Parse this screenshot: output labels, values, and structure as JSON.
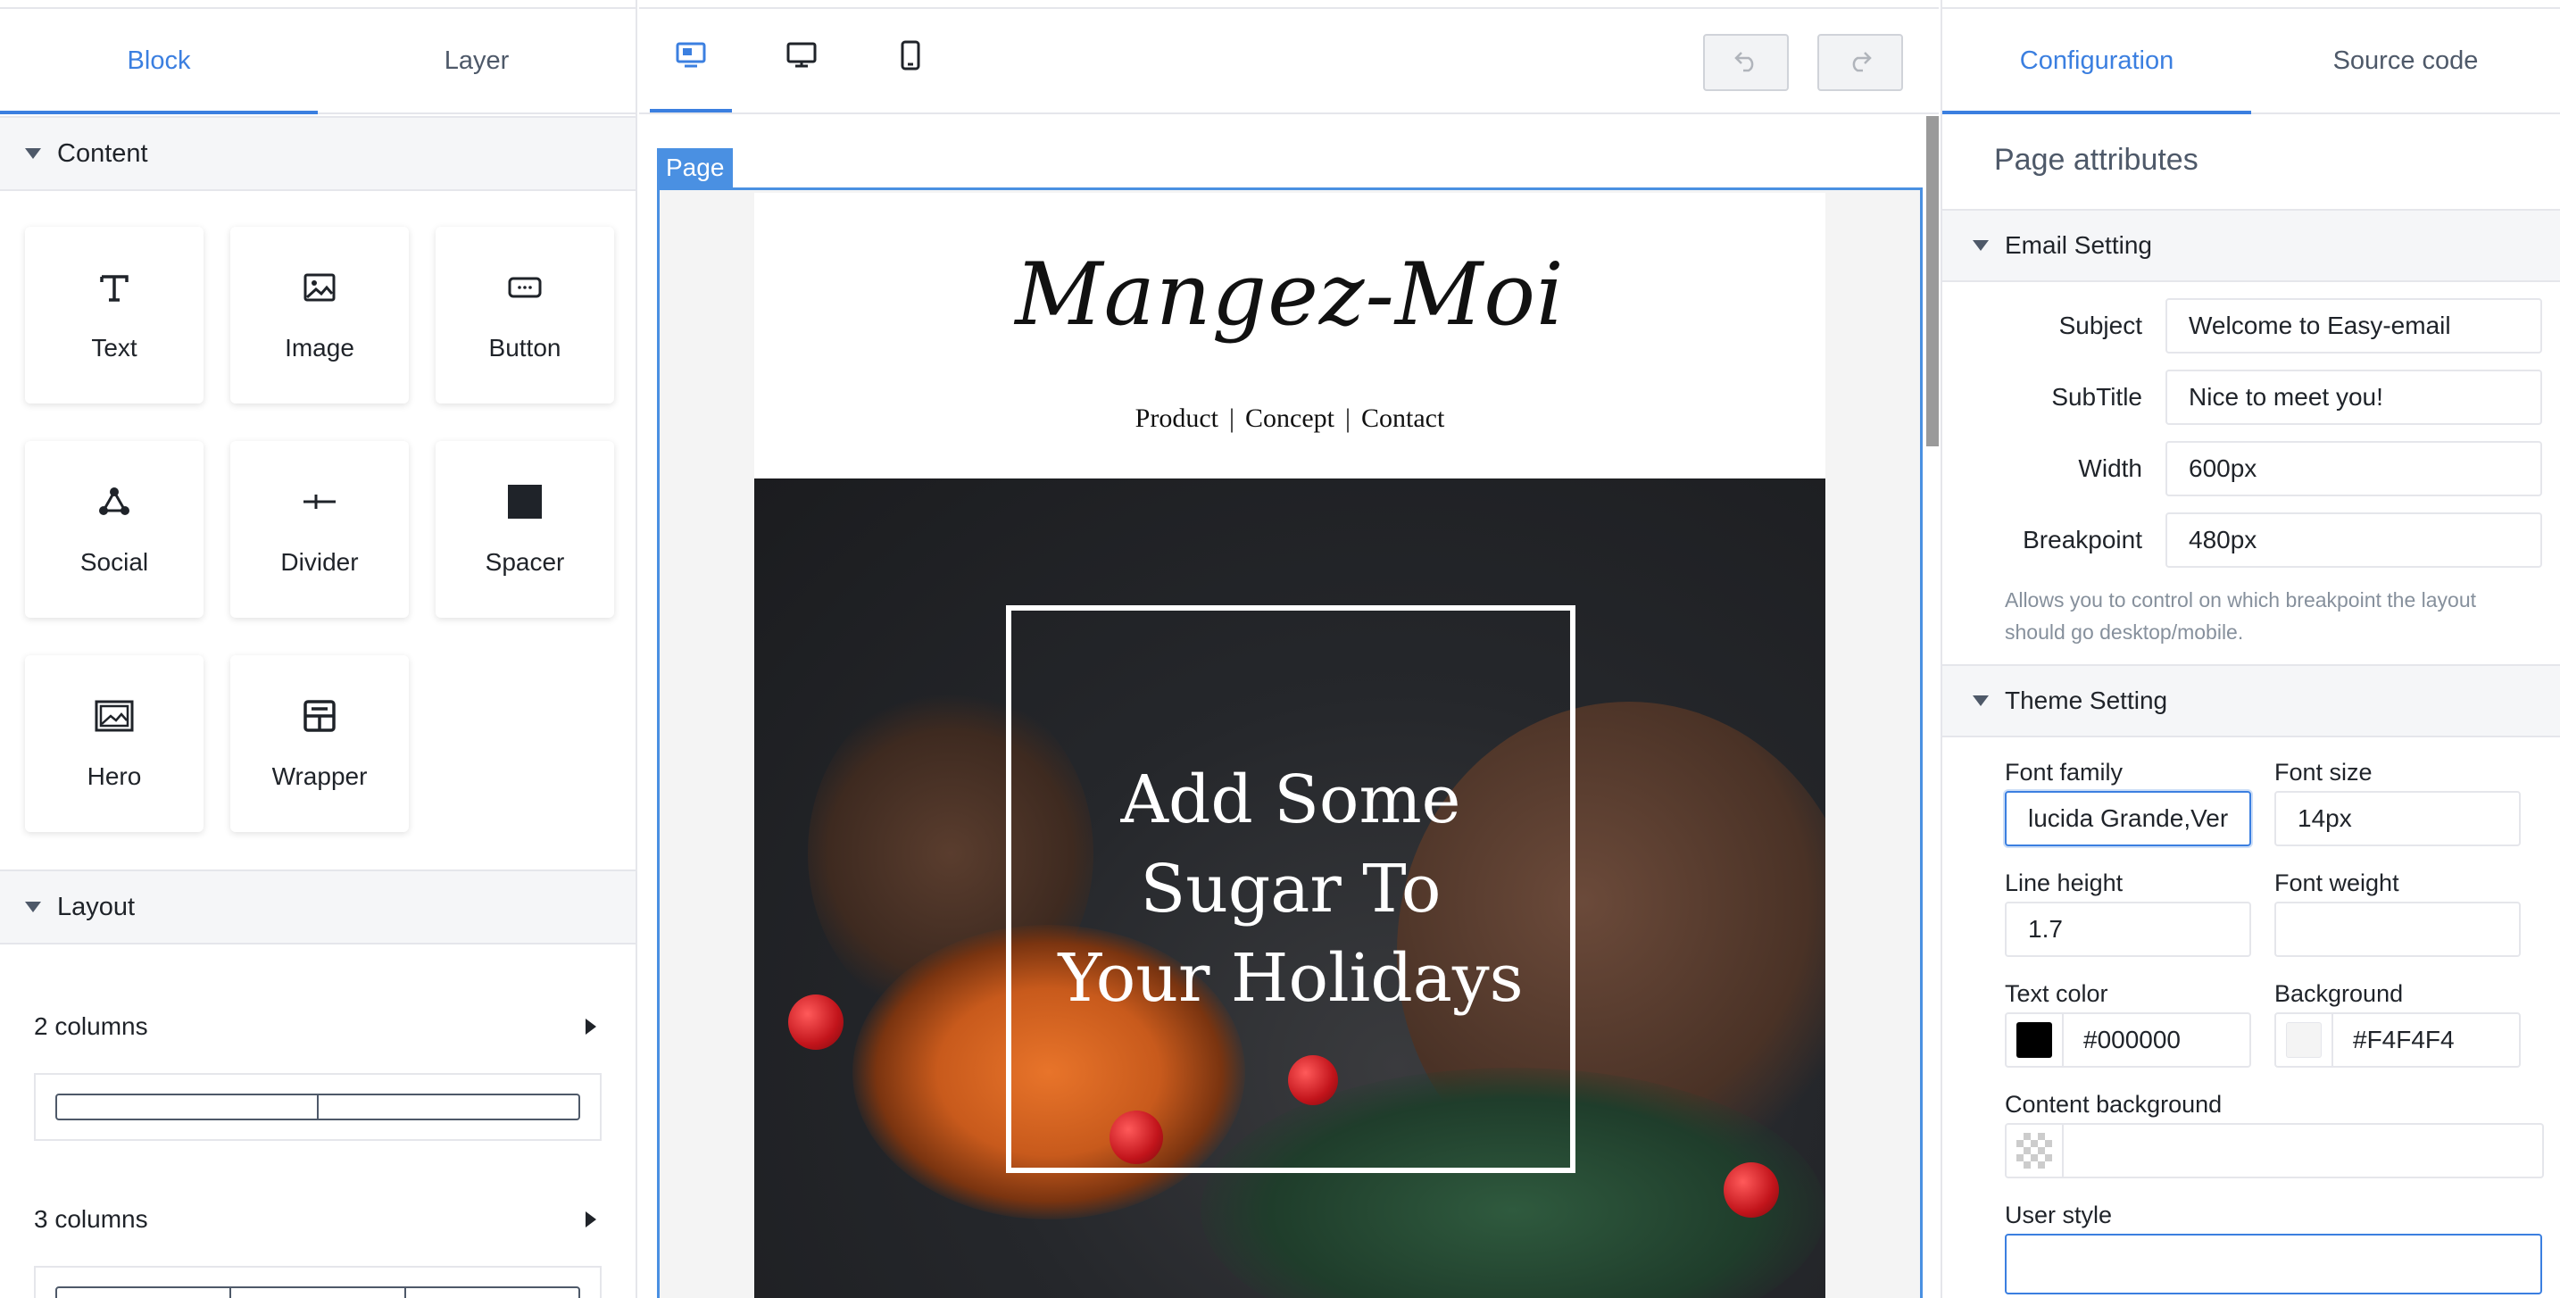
{
  "left_panel": {
    "tabs": [
      {
        "label": "Block",
        "active": true
      },
      {
        "label": "Layer",
        "active": false
      }
    ],
    "content_section": {
      "title": "Content",
      "blocks": [
        {
          "label": "Text",
          "icon": "text-icon"
        },
        {
          "label": "Image",
          "icon": "image-icon"
        },
        {
          "label": "Button",
          "icon": "button-icon"
        },
        {
          "label": "Social",
          "icon": "social-icon"
        },
        {
          "label": "Divider",
          "icon": "divider-icon"
        },
        {
          "label": "Spacer",
          "icon": "spacer-icon"
        },
        {
          "label": "Hero",
          "icon": "hero-icon"
        },
        {
          "label": "Wrapper",
          "icon": "wrapper-icon"
        }
      ]
    },
    "layout_section": {
      "title": "Layout",
      "items": [
        {
          "label": "2 columns"
        },
        {
          "label": "3 columns"
        }
      ]
    }
  },
  "toolbar": {
    "devices": [
      "editor-icon",
      "desktop-icon",
      "mobile-icon"
    ],
    "undo_icon": "undo-icon",
    "redo_icon": "redo-icon"
  },
  "canvas": {
    "page_tag": "Page",
    "logo": "Mangez-Moi",
    "nav": [
      "Product",
      "|",
      "Concept",
      "|",
      "Contact"
    ],
    "hero_lines": [
      "Add Some",
      "Sugar To",
      "Your Holidays"
    ]
  },
  "right_panel": {
    "tabs": [
      {
        "label": "Configuration",
        "active": true
      },
      {
        "label": "Source code",
        "active": false
      }
    ],
    "title": "Page attributes",
    "email_setting": {
      "title": "Email Setting",
      "subject_label": "Subject",
      "subject_value": "Welcome to Easy-email",
      "subtitle_label": "SubTitle",
      "subtitle_value": "Nice to meet you!",
      "width_label": "Width",
      "width_value": "600px",
      "breakpoint_label": "Breakpoint",
      "breakpoint_value": "480px",
      "breakpoint_hint": "Allows you to control on which breakpoint the layout should go desktop/mobile."
    },
    "theme_setting": {
      "title": "Theme Setting",
      "font_family_label": "Font family",
      "font_family_value": "lucida Grande,Ver",
      "font_size_label": "Font size",
      "font_size_value": "14px",
      "line_height_label": "Line height",
      "line_height_value": "1.7",
      "font_weight_label": "Font weight",
      "font_weight_value": "",
      "text_color_label": "Text color",
      "text_color_value": "#000000",
      "background_label": "Background",
      "background_value": "#F4F4F4",
      "content_background_label": "Content background",
      "content_background_value": "",
      "user_style_label": "User style"
    }
  },
  "colors": {
    "accent": "#3b7fe0",
    "page_outline": "#4a90e2",
    "text_color_swatch": "#000000",
    "background_swatch": "#F4F4F4"
  }
}
